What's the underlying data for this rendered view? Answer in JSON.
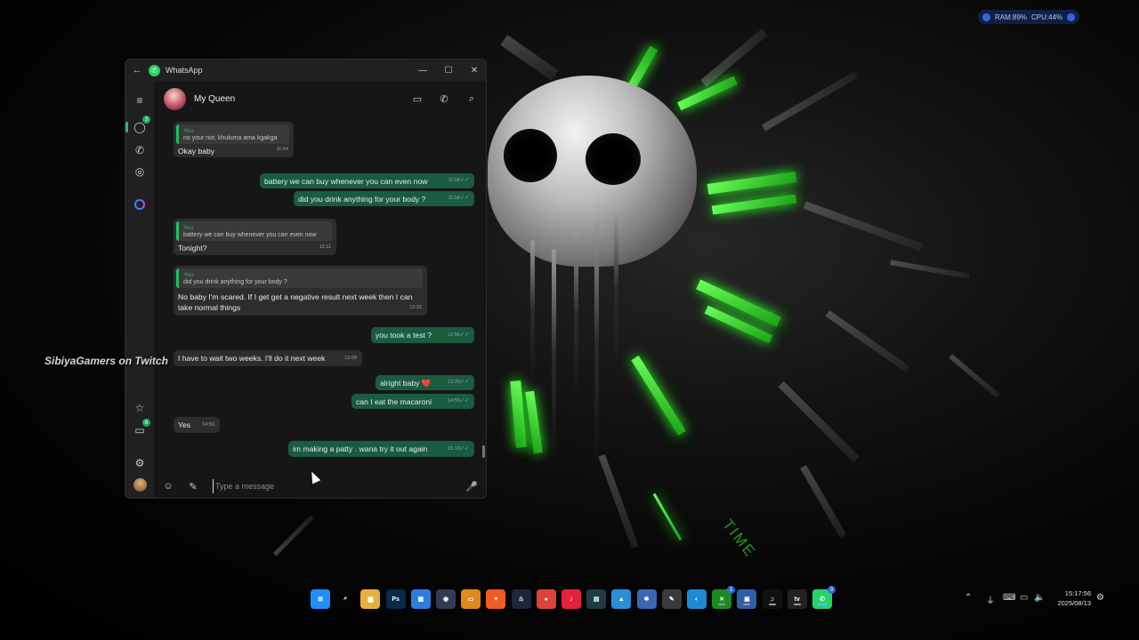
{
  "system_monitor": {
    "ram": "RAM:89%",
    "cpu": "CPU:44%"
  },
  "watermark": "SibiyaGamers on Twitch",
  "wallpaper": {
    "text": "TIME",
    "accent_color": "#2fff2a"
  },
  "window": {
    "app_name": "WhatsApp",
    "rail": {
      "chats_badge": "3",
      "communities_badge": "6"
    },
    "chat": {
      "contact_name": "My Queen",
      "messages": [
        {
          "direction": "in",
          "quote_author": "You",
          "quote_text": "no your not. khuluma ama kgakga",
          "text": "Okay baby",
          "time": "11:54"
        },
        {
          "direction": "out",
          "text": "battery we can buy whenever you can even now",
          "time": "11:58"
        },
        {
          "direction": "out",
          "text": "did you drink anything for your body ?",
          "time": "11:58"
        },
        {
          "direction": "in",
          "quote_author": "You",
          "quote_text": "battery we can buy whenever you can even now",
          "text": "Tonight?",
          "time": "12:11"
        },
        {
          "direction": "in",
          "quote_author": "You",
          "quote_text": "did you drink anything for your body ?",
          "text": "No baby I'm scared. If I get get a negative result next week then I can",
          "text2": "take normal things",
          "time": "12:15"
        },
        {
          "direction": "out",
          "text": "you took a test ?",
          "time": "12:55"
        },
        {
          "direction": "in",
          "text": "I have to wait two weeks. I'll do it next week",
          "time": "13:09"
        },
        {
          "direction": "out",
          "text": "alright baby ❤️",
          "time": "13:29"
        },
        {
          "direction": "out",
          "text": "can I eat the macaroni",
          "time": "14:55"
        },
        {
          "direction": "in",
          "text": "Yes",
          "time": "14:59"
        },
        {
          "direction": "out",
          "text": "im making a patty . wana try it out again",
          "time": "15:10"
        }
      ]
    },
    "composer": {
      "placeholder": "Type a message"
    }
  },
  "taskbar": {
    "apps": [
      {
        "name": "start",
        "color": "#1f8fff",
        "glyph": "⊞"
      },
      {
        "name": "search",
        "color": "transparent",
        "glyph": "⌕"
      },
      {
        "name": "file-explorer",
        "color": "#e8b03a",
        "glyph": "▆"
      },
      {
        "name": "photoshop",
        "color": "#0b2a4a",
        "glyph": "Ps"
      },
      {
        "name": "store",
        "color": "#2b7de0",
        "glyph": "▦"
      },
      {
        "name": "obs",
        "color": "#333a55",
        "glyph": "◉"
      },
      {
        "name": "app-orange",
        "color": "#e08a1e",
        "glyph": "▭"
      },
      {
        "name": "brave",
        "color": "#f05a24",
        "glyph": "▼"
      },
      {
        "name": "steam",
        "color": "#1b2838",
        "glyph": "♨"
      },
      {
        "name": "chrome",
        "color": "#db4437",
        "glyph": "●"
      },
      {
        "name": "app-red",
        "color": "#e4233a",
        "glyph": "♪"
      },
      {
        "name": "capcut",
        "color": "#1f3a44",
        "glyph": "▤"
      },
      {
        "name": "photos",
        "color": "#2b8fd6",
        "glyph": "▲"
      },
      {
        "name": "settings-app",
        "color": "#3a66b8",
        "glyph": "✱"
      },
      {
        "name": "editor",
        "color": "#3a3a3a",
        "glyph": "✎"
      },
      {
        "name": "edge",
        "color": "#1c8bd6",
        "glyph": "◐"
      },
      {
        "name": "xbox",
        "color": "#1d8a1d",
        "glyph": "✕",
        "badge": "1"
      },
      {
        "name": "gallery",
        "color": "#2d5fa8",
        "glyph": "▣"
      },
      {
        "name": "tiktok",
        "color": "#111111",
        "glyph": "♫"
      },
      {
        "name": "tv",
        "color": "#222222",
        "glyph": "tv"
      },
      {
        "name": "whatsapp",
        "color": "#25d366",
        "glyph": "✆",
        "badge": "3"
      }
    ],
    "clock": {
      "time": "15:17:56",
      "date": "2025/08/13"
    }
  }
}
